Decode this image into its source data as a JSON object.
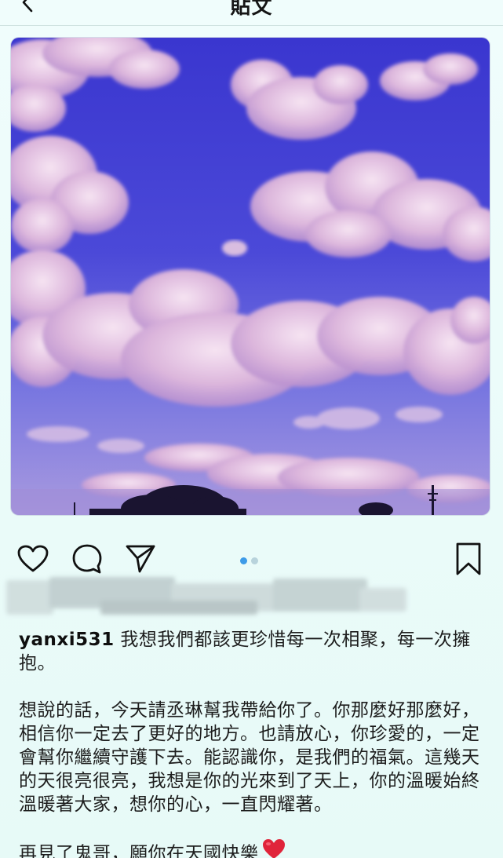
{
  "header": {
    "title": "貼文",
    "back_icon": "chevron-left-icon"
  },
  "post": {
    "image_alt": "",
    "carousel": {
      "count": 2,
      "active": 0
    }
  },
  "actions": {
    "icons": [
      "heart-icon",
      "comment-icon",
      "share-icon",
      "bookmark-icon"
    ]
  },
  "caption": {
    "username": "yanxi531",
    "first_line": " 我想我們都該更珍惜每一次相聚，每一次擁抱。",
    "paragraph_2": "想說的話，今天請丞琳幫我帶給你了。你那麼好那麼好，相信你一定去了更好的地方。也請放心，你珍愛的，一定會幫你繼續守護下去。能認識你，是我們的福氣。這幾天的天很亮很亮，我想是你的光來到了天上，你的溫暖始終溫暖著大家，想你的心，一直閃耀著。",
    "paragraph_3": "再見了鬼哥，願你在天國快樂",
    "emoji": "heart-emoji"
  },
  "colors": {
    "background": "#eefcfb",
    "sky_top": "#3e3fd6",
    "sky_bottom": "#8d86dc",
    "cloud": "#e6c6e4",
    "dot_active": "#3d9be8",
    "heart": "#e0243a"
  }
}
